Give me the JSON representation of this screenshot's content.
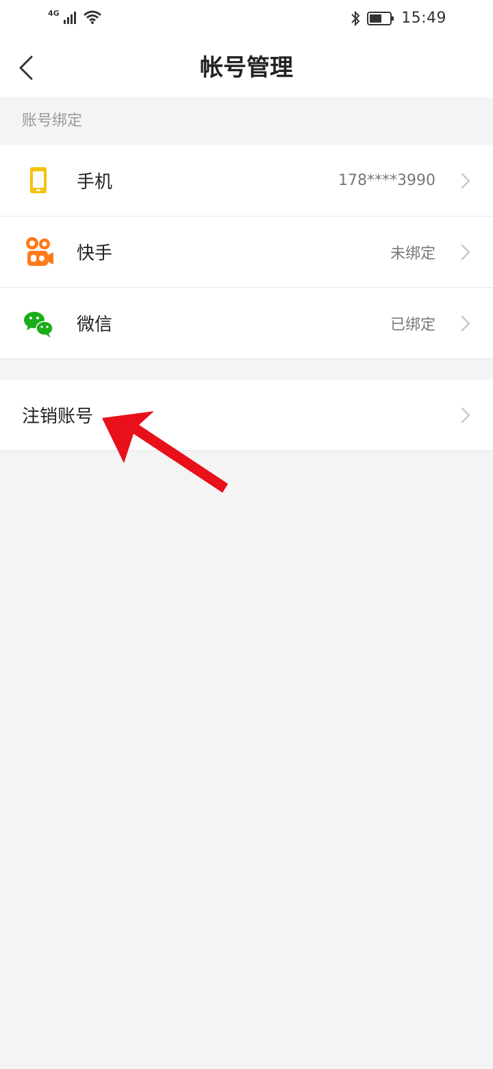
{
  "status_bar": {
    "network": "4G",
    "time": "15:49"
  },
  "header": {
    "title": "帐号管理",
    "back_icon": "chevron-left-icon"
  },
  "section": {
    "label": "账号绑定"
  },
  "bindings": [
    {
      "label": "手机",
      "value": "178****3990",
      "icon": "phone-icon",
      "icon_color": "#f5c20b"
    },
    {
      "label": "快手",
      "value": "未绑定",
      "icon": "kuaishou-icon",
      "icon_color": "#ff7a1a"
    },
    {
      "label": "微信",
      "value": "已绑定",
      "icon": "wechat-icon",
      "icon_color": "#1aad19"
    }
  ],
  "account": {
    "cancel_label": "注销账号"
  },
  "annotation": {
    "arrow_color": "#e8101a"
  }
}
